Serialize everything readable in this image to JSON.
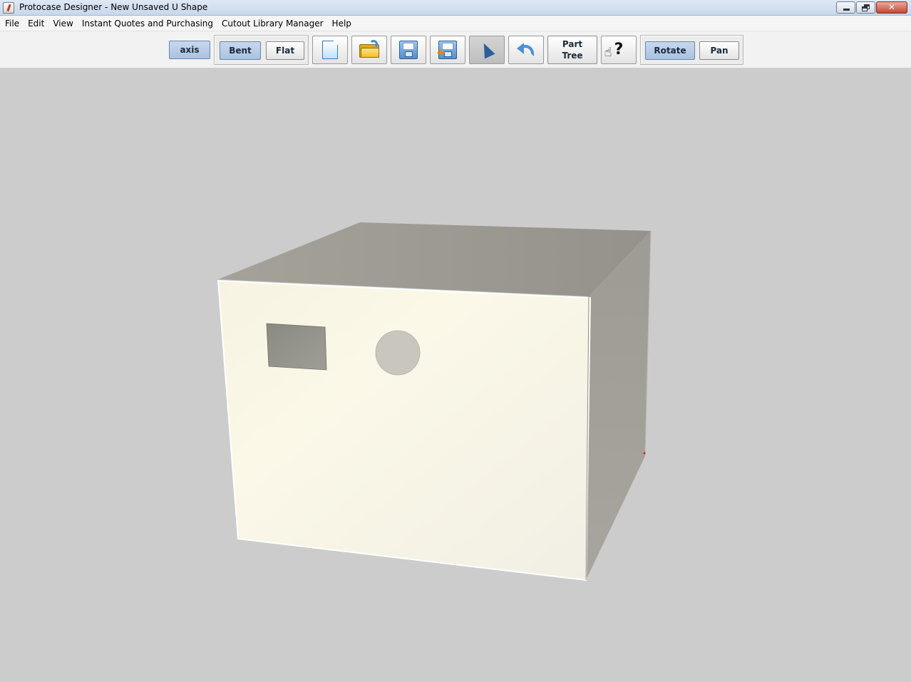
{
  "window": {
    "title": "Protocase Designer - New Unsaved U Shape",
    "controls": {
      "minimize": "minimize",
      "restore": "restore",
      "close": "close"
    }
  },
  "menu": {
    "items": [
      "File",
      "Edit",
      "View",
      "Instant Quotes and Purchasing",
      "Cutout Library Manager",
      "Help"
    ]
  },
  "toolbar": {
    "axis_label": "axis",
    "bent_label": "Bent",
    "flat_label": "Flat",
    "part_tree_line1": "Part",
    "part_tree_line2": "Tree",
    "rotate_label": "Rotate",
    "pan_label": "Pan",
    "icons": [
      "new-document-icon",
      "open-folder-icon",
      "save-disk-icon",
      "save-as-disk-icon",
      "select-cursor-icon",
      "undo-arrow-icon",
      "help-hand-icon"
    ],
    "active": [
      "axis",
      "Bent",
      "Rotate"
    ]
  },
  "viewport": {
    "background": "#cccccc",
    "box_front_color": "#f7f4e6",
    "box_top_color": "#9e9c94",
    "box_side_color": "#a19f97",
    "cutouts": [
      "rectangle",
      "circle"
    ]
  }
}
